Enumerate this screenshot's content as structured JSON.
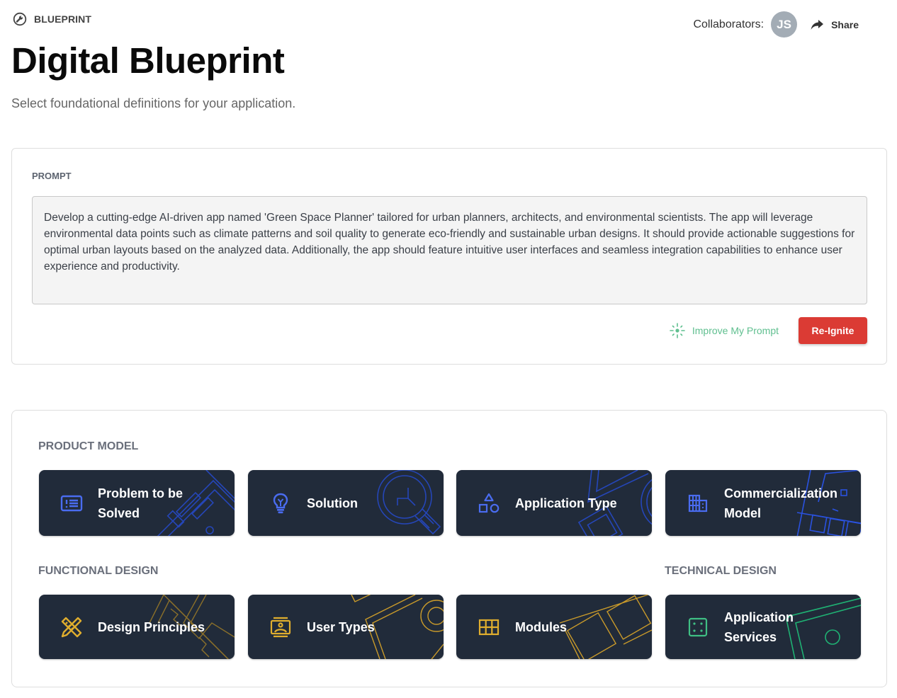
{
  "header": {
    "breadcrumb_label": "BLUEPRINT",
    "title": "Digital Blueprint",
    "subtitle": "Select foundational definitions for your application.",
    "collaborators_label": "Collaborators:",
    "avatar_initials": "JS",
    "share_label": "Share"
  },
  "prompt": {
    "label": "PROMPT",
    "value": "Develop a cutting-edge AI-driven app named 'Green Space Planner' tailored for urban planners, architects, and environmental scientists. The app will leverage environmental data points such as climate patterns and soil quality to generate eco-friendly and sustainable urban designs. It should provide actionable suggestions for optimal urban layouts based on the analyzed data. Additionally, the app should feature intuitive user interfaces and seamless integration capabilities to enhance user experience and productivity.",
    "improve_label": "Improve My Prompt",
    "reignite_label": "Re-Ignite"
  },
  "colors": {
    "product_accent": "#4a6cf0",
    "functional_accent": "#e0ae2e",
    "technical_accent": "#3fbf84",
    "tile_bg": "#212b3a",
    "reignite": "#db3b34",
    "improve": "#5fbf8f"
  },
  "sections": {
    "product_model": {
      "label": "PRODUCT MODEL",
      "tiles": [
        {
          "label": "Problem to be Solved",
          "icon": "problem-list-icon"
        },
        {
          "label": "Solution",
          "icon": "lightbulb-icon"
        },
        {
          "label": "Application Type",
          "icon": "shapes-icon"
        },
        {
          "label": "Commercialization Model",
          "icon": "building-icon"
        }
      ]
    },
    "functional_design": {
      "label": "FUNCTIONAL DESIGN",
      "tiles": [
        {
          "label": "Design Principles",
          "icon": "ruler-pencil-icon"
        },
        {
          "label": "User Types",
          "icon": "user-portrait-icon"
        },
        {
          "label": "Modules",
          "icon": "grid-icon"
        }
      ]
    },
    "technical_design": {
      "label": "TECHNICAL DESIGN",
      "tiles": [
        {
          "label": "Application Services",
          "icon": "dice-icon"
        }
      ]
    }
  }
}
